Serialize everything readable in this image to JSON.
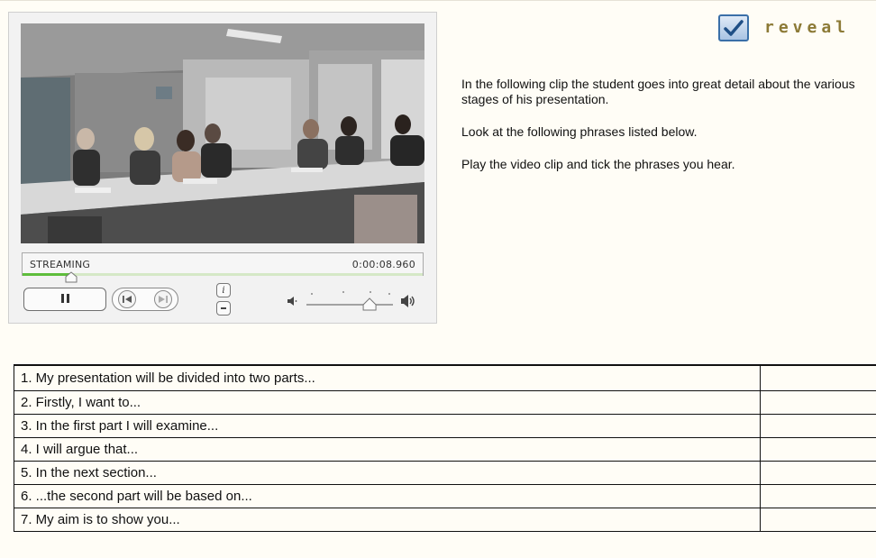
{
  "player": {
    "stream_label": "STREAMING",
    "timecode": "0:00:08.960",
    "progress": 0.12,
    "volume": 0.73,
    "icons": {
      "pause": "pause-icon",
      "previous": "previous-icon",
      "next": "next-icon",
      "info": "info-icon",
      "menu": "menu-icon",
      "volume_low": "volume-low-icon",
      "volume_high": "volume-high-icon"
    }
  },
  "reveal": {
    "label": "reveal",
    "icon": "checkbox-checked-icon",
    "accent": "#8c7a36",
    "check_color": "#3a6fa8"
  },
  "instructions": [
    "In the following clip the student goes into great detail about the various stages of his presentation.",
    "Look at the following phrases listed below.",
    "Play the video clip and tick the phrases you hear."
  ],
  "phrases": [
    "1. My presentation will be divided into two parts...",
    "2. Firstly, I want to...",
    "3. In the first part I will examine...",
    "4. I will argue that...",
    "5. In the next section...",
    "6. ...the second part will be based on...",
    "7. My aim is to show you..."
  ],
  "colors": {
    "page_background": "#fffdf6",
    "progress_green": "#5ebd3c"
  }
}
